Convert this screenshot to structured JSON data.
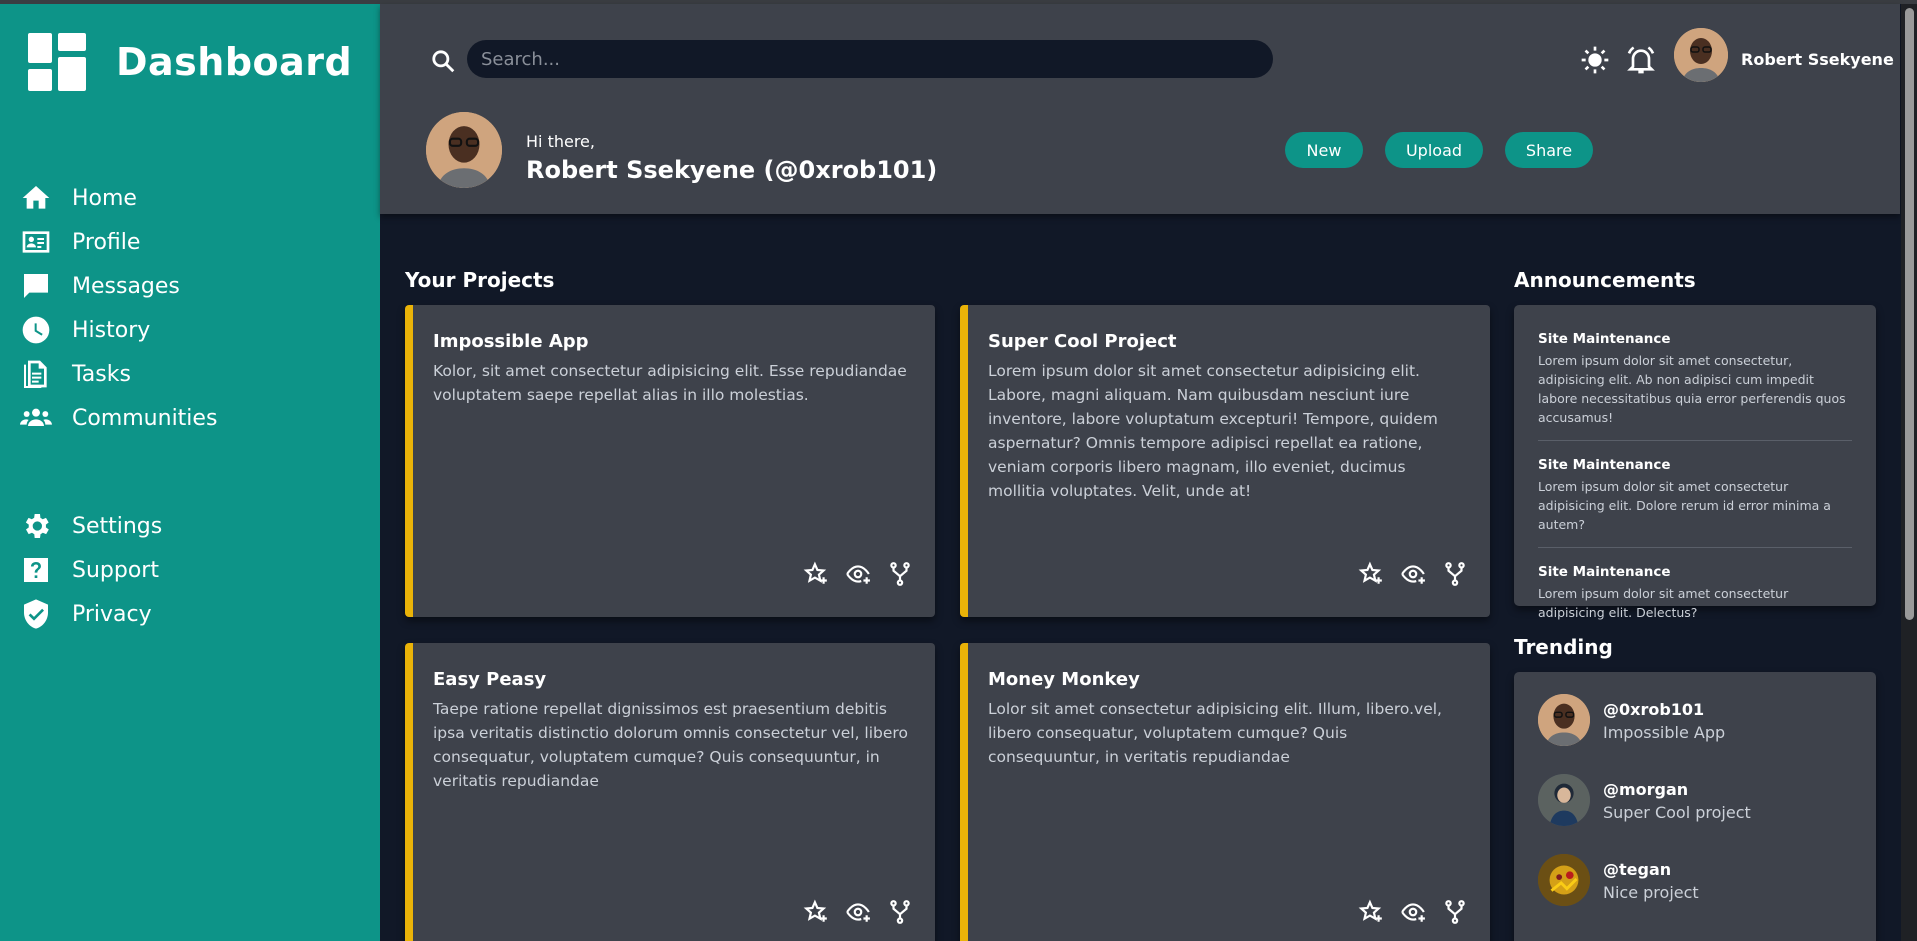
{
  "brand": {
    "title": "Dashboard"
  },
  "sidebar": {
    "items": [
      {
        "label": "Home",
        "icon": "home-icon"
      },
      {
        "label": "Profile",
        "icon": "profile-card-icon"
      },
      {
        "label": "Messages",
        "icon": "message-icon"
      },
      {
        "label": "History",
        "icon": "clock-icon"
      },
      {
        "label": "Tasks",
        "icon": "document-icon"
      },
      {
        "label": "Communities",
        "icon": "users-icon"
      }
    ],
    "secondary": [
      {
        "label": "Settings",
        "icon": "gear-icon"
      },
      {
        "label": "Support",
        "icon": "question-icon"
      },
      {
        "label": "Privacy",
        "icon": "shield-icon"
      }
    ]
  },
  "header": {
    "search_placeholder": "Search...",
    "user_name": "Robert Ssekyene",
    "greeting": "Hi there,",
    "full_name": "Robert Ssekyene (@0xrob101)",
    "buttons": {
      "new": "New",
      "upload": "Upload",
      "share": "Share"
    }
  },
  "projects": {
    "title": "Your Projects",
    "cards": [
      {
        "title": "Impossible App",
        "desc": "Kolor, sit amet consectetur adipisicing elit. Esse repudiandae voluptatem saepe repellat alias in illo molestias."
      },
      {
        "title": "Super Cool Project",
        "desc": "Lorem ipsum dolor sit amet consectetur adipisicing elit. Labore, magni aliquam. Nam quibusdam nesciunt iure inventore, labore voluptatum excepturi! Tempore, quidem aspernatur? Omnis tempore adipisci repellat ea ratione, veniam corporis libero magnam, illo eveniet, ducimus mollitia voluptates. Velit, unde at!"
      },
      {
        "title": "Easy Peasy",
        "desc": "Taepe ratione repellat dignissimos est praesentium debitis ipsa veritatis distinctio dolorum omnis consectetur vel, libero consequatur, voluptatem cumque? Quis consequuntur, in veritatis repudiandae"
      },
      {
        "title": "Money Monkey",
        "desc": "Lolor sit amet consectetur adipisicing elit. Illum, libero.vel, libero consequatur, voluptatem cumque? Quis consequuntur, in veritatis repudiandae"
      }
    ]
  },
  "announcements": {
    "title": "Announcements",
    "items": [
      {
        "title": "Site Maintenance",
        "body": "Lorem ipsum dolor sit amet consectetur, adipisicing elit. Ab non adipisci cum impedit labore necessitatibus quia error perferendis quos accusamus!"
      },
      {
        "title": "Site Maintenance",
        "body": "Lorem ipsum dolor sit amet consectetur adipisicing elit. Dolore rerum id error minima a autem?"
      },
      {
        "title": "Site Maintenance",
        "body": "Lorem ipsum dolor sit amet consectetur adipisicing elit. Delectus?"
      }
    ]
  },
  "trending": {
    "title": "Trending",
    "items": [
      {
        "handle": "@0xrob101",
        "project": "Impossible App"
      },
      {
        "handle": "@morgan",
        "project": "Super Cool project"
      },
      {
        "handle": "@tegan",
        "project": "Nice project"
      }
    ]
  },
  "colors": {
    "teal": "#0d9488",
    "accent": "#eab308",
    "panel": "#3e424b",
    "background": "#111827"
  }
}
